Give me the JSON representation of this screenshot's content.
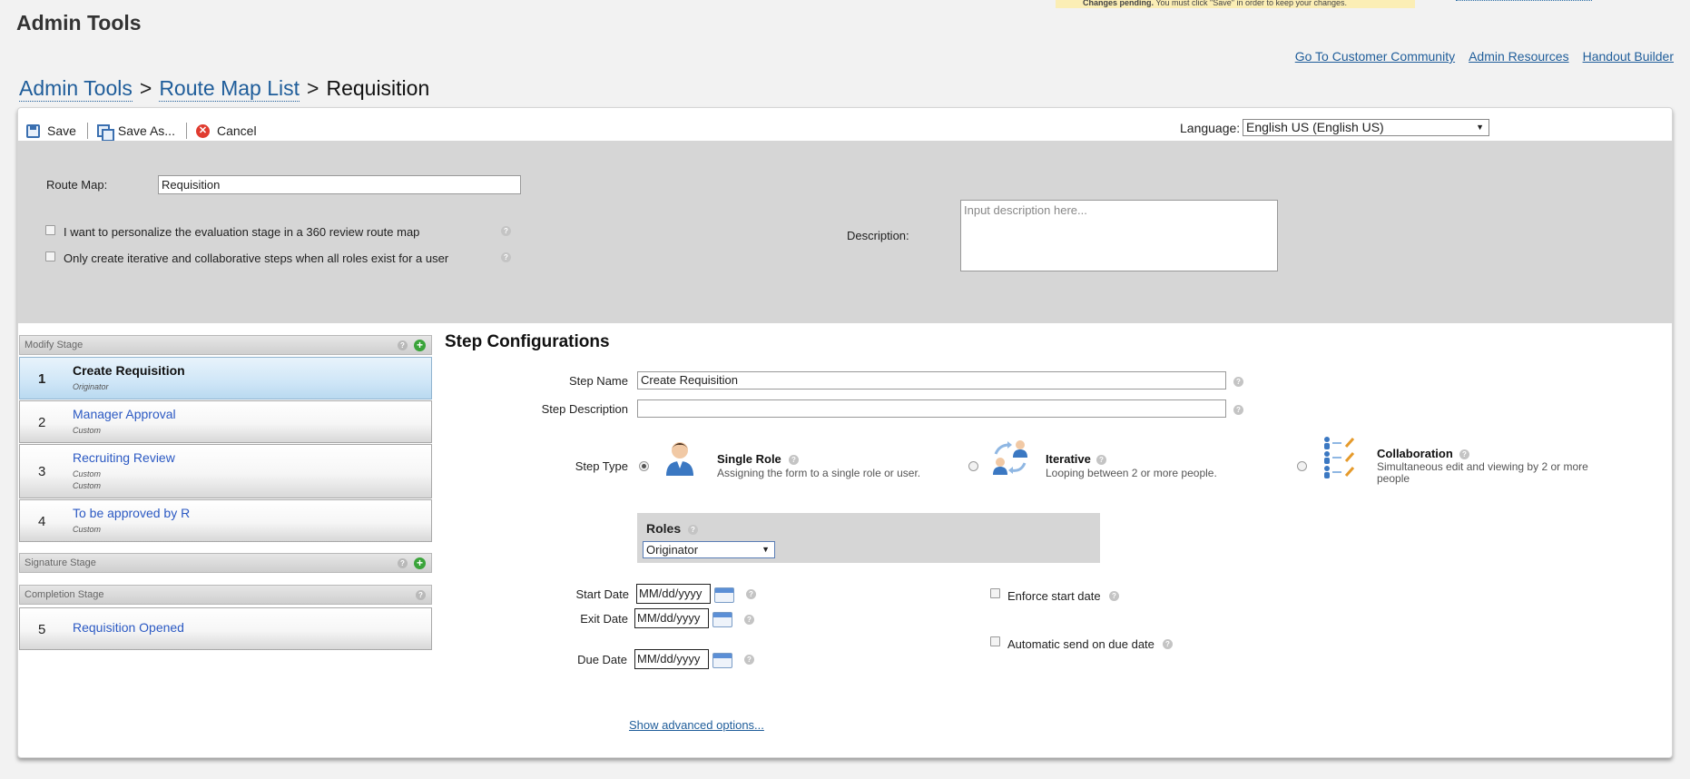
{
  "app": {
    "title": "Admin Tools"
  },
  "banner": {
    "bold_text": "Changes pending.",
    "text": "You must click \"Save\" in order to keep your changes."
  },
  "top_links": [
    "Go To Customer Community",
    "Admin Resources",
    "Handout Builder"
  ],
  "breadcrumb": {
    "items": [
      "Admin Tools",
      "Route Map List"
    ],
    "current": "Requisition",
    "separator": ">"
  },
  "toolbar": {
    "save": "Save",
    "save_as": "Save As...",
    "cancel": "Cancel"
  },
  "language": {
    "label": "Language:",
    "value": "English US (English US)"
  },
  "route_map": {
    "label": "Route Map:",
    "value": "Requisition",
    "option1": "I want to personalize the evaluation stage in a 360 review route map",
    "option2": "Only create iterative and collaborative steps when all roles exist for a user",
    "description_label": "Description:",
    "description_placeholder": "Input description here..."
  },
  "stages": {
    "modify": "Modify Stage",
    "signature": "Signature Stage",
    "completion": "Completion Stage",
    "steps": [
      {
        "num": "1",
        "title": "Create Requisition",
        "subs": [
          "Originator"
        ]
      },
      {
        "num": "2",
        "title": "Manager Approval",
        "subs": [
          "Custom"
        ]
      },
      {
        "num": "3",
        "title": "Recruiting Review",
        "subs": [
          "Custom",
          "Custom"
        ]
      },
      {
        "num": "4",
        "title": "To be approved by R",
        "subs": [
          "Custom"
        ]
      }
    ],
    "completion_steps": [
      {
        "num": "5",
        "title": "Requisition Opened"
      }
    ]
  },
  "step_config": {
    "title": "Step Configurations",
    "step_name_label": "Step Name",
    "step_name_value": "Create Requisition",
    "step_desc_label": "Step Description",
    "step_desc_value": "",
    "step_type_label": "Step Type",
    "types": [
      {
        "name": "Single Role",
        "desc": "Assigning the form to a single role or user."
      },
      {
        "name": "Iterative",
        "desc": "Looping between 2 or more people."
      },
      {
        "name": "Collaboration",
        "desc": "Simultaneous edit and viewing by 2 or more people"
      }
    ],
    "selected_type": "Single Role",
    "roles_label": "Roles",
    "roles_value": "Originator",
    "start_date_label": "Start Date",
    "exit_date_label": "Exit Date",
    "due_date_label": "Due Date",
    "date_placeholder": "MM/dd/yyyy",
    "enforce_label": "Enforce start date",
    "auto_send_label": "Automatic send on due date",
    "advanced_link": "Show advanced options..."
  },
  "colors": {
    "link": "#1f5d9a",
    "step_link": "#2b59c3",
    "gray_panel": "#d6d6d6",
    "add_green": "#3aa43a"
  }
}
